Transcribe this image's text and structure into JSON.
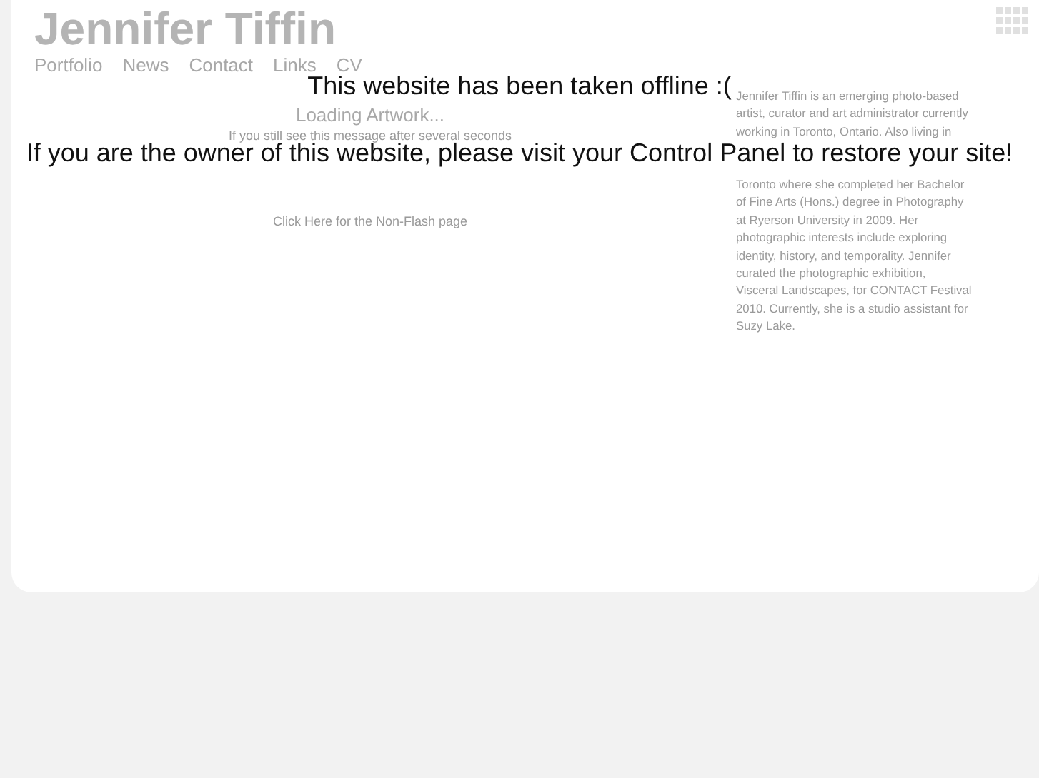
{
  "site": {
    "title": "Jennifer Tiffin",
    "nav": [
      {
        "label": "Portfolio"
      },
      {
        "label": "News"
      },
      {
        "label": "Contact"
      },
      {
        "label": "Links"
      },
      {
        "label": "CV"
      }
    ]
  },
  "content": {
    "loading": "Loading Artwork...",
    "hint": "If you still see this message after several seconds",
    "link": "Click Here for the Non-Flash page"
  },
  "bio": {
    "upper": [
      "Jennifer Tiffin is an emerging photo-based",
      "artist, curator and art administrator currently",
      "working in Toronto, Ontario. Also living in"
    ],
    "lower": [
      "Toronto where she completed her Bachelor",
      "of Fine Arts (Hons.) degree in Photography",
      "at Ryerson University in 2009. Her",
      "photographic interests include exploring",
      "identity, history, and temporality. Jennifer",
      "curated the photographic exhibition,",
      "Visceral Landscapes, for CONTACT Festival",
      "2010. Currently, she is a studio assistant for",
      "Suzy Lake."
    ]
  },
  "notice": {
    "title": "This website has been taken offline :(",
    "message": "If you are the owner of this website, please visit your Control Panel to restore your site!"
  }
}
